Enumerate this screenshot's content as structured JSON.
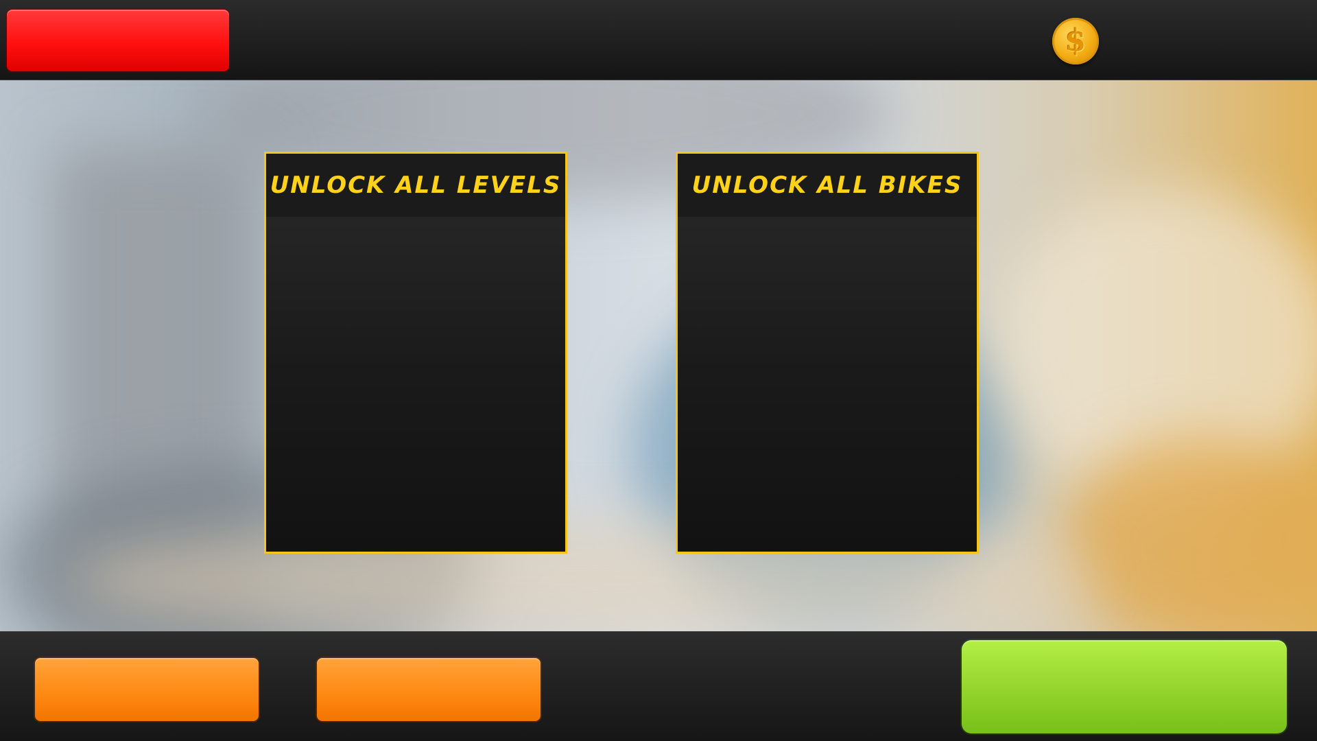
{
  "top_bar": {
    "back_button_label": "",
    "coin_icon": "coin-dollar-icon",
    "coin_glyph": "$",
    "coin_count": ""
  },
  "panels": [
    {
      "title": "UNLOCK ALL LEVELS"
    },
    {
      "title": "UNLOCK ALL BIKES"
    }
  ],
  "bottom_bar": {
    "orange_button_1_label": "",
    "orange_button_2_label": "",
    "green_button_label": ""
  },
  "colors": {
    "accent_yellow": "#f5c518",
    "title_yellow": "#ffd21a",
    "red_button": "#ff1a1a",
    "orange_button": "#ff8a14",
    "green_button": "#96d62e",
    "coin_gold": "#f3ac12"
  }
}
